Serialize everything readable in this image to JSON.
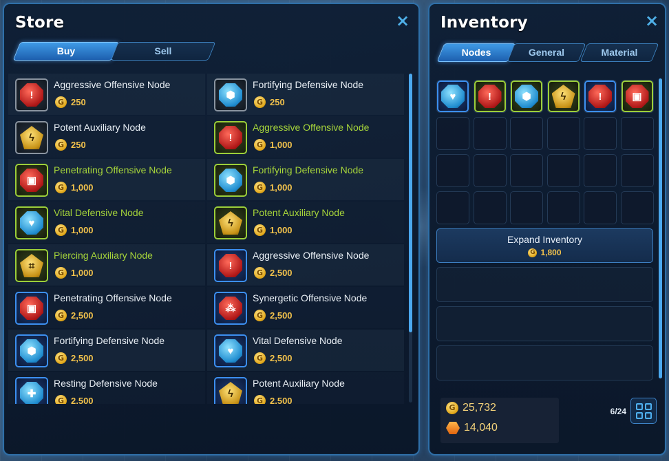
{
  "store": {
    "title": "Store",
    "close_icon": "×",
    "tabs": [
      {
        "label": "Buy",
        "active": true
      },
      {
        "label": "Sell",
        "active": false
      }
    ],
    "items": [
      {
        "name": "Aggressive Offensive Node",
        "price": "250",
        "gem": "red",
        "glyph": "!",
        "frame": "grey",
        "highlight": false
      },
      {
        "name": "Fortifying Defensive Node",
        "price": "250",
        "gem": "blue",
        "glyph": "⬢",
        "frame": "grey",
        "highlight": false
      },
      {
        "name": "Potent Auxiliary Node",
        "price": "250",
        "gem": "gold",
        "glyph": "ϟ",
        "frame": "grey",
        "highlight": false
      },
      {
        "name": "Aggressive Offensive Node",
        "price": "1,000",
        "gem": "red",
        "glyph": "!",
        "frame": "green",
        "highlight": true
      },
      {
        "name": "Penetrating Offensive Node",
        "price": "1,000",
        "gem": "red",
        "glyph": "▣",
        "frame": "green",
        "highlight": true
      },
      {
        "name": "Fortifying Defensive Node",
        "price": "1,000",
        "gem": "blue",
        "glyph": "⬢",
        "frame": "green",
        "highlight": true
      },
      {
        "name": "Vital Defensive Node",
        "price": "1,000",
        "gem": "blue",
        "glyph": "♥",
        "frame": "green",
        "highlight": true
      },
      {
        "name": "Potent Auxiliary Node",
        "price": "1,000",
        "gem": "gold",
        "glyph": "ϟ",
        "frame": "green",
        "highlight": true
      },
      {
        "name": "Piercing Auxiliary Node",
        "price": "1,000",
        "gem": "gold",
        "glyph": "⌗",
        "frame": "green",
        "highlight": true
      },
      {
        "name": "Aggressive Offensive Node",
        "price": "2,500",
        "gem": "red",
        "glyph": "!",
        "frame": "blue",
        "highlight": false
      },
      {
        "name": "Penetrating Offensive Node",
        "price": "2,500",
        "gem": "red",
        "glyph": "▣",
        "frame": "blue",
        "highlight": false
      },
      {
        "name": "Synergetic Offensive Node",
        "price": "2,500",
        "gem": "red",
        "glyph": "⁂",
        "frame": "blue",
        "highlight": false
      },
      {
        "name": "Fortifying Defensive Node",
        "price": "2,500",
        "gem": "blue",
        "glyph": "⬢",
        "frame": "blue",
        "highlight": false
      },
      {
        "name": "Vital Defensive Node",
        "price": "2,500",
        "gem": "blue",
        "glyph": "♥",
        "frame": "blue",
        "highlight": false
      },
      {
        "name": "Resting Defensive Node",
        "price": "2,500",
        "gem": "blue",
        "glyph": "✚",
        "frame": "blue",
        "highlight": false
      },
      {
        "name": "Potent Auxiliary Node",
        "price": "2,500",
        "gem": "gold",
        "glyph": "ϟ",
        "frame": "blue",
        "highlight": false
      }
    ]
  },
  "inventory": {
    "title": "Inventory",
    "close_icon": "×",
    "tabs": [
      {
        "label": "Nodes",
        "active": true
      },
      {
        "label": "General",
        "active": false
      },
      {
        "label": "Material",
        "active": false
      }
    ],
    "slots_filled": [
      {
        "gem": "blue",
        "glyph": "♥",
        "frame": "blue"
      },
      {
        "gem": "red",
        "glyph": "!",
        "frame": "green"
      },
      {
        "gem": "blue",
        "glyph": "⬢",
        "frame": "green"
      },
      {
        "gem": "gold",
        "glyph": "ϟ",
        "frame": "green"
      },
      {
        "gem": "red",
        "glyph": "!",
        "frame": "blue"
      },
      {
        "gem": "red",
        "glyph": "▣",
        "frame": "green"
      }
    ],
    "expand": {
      "label": "Expand Inventory",
      "price": "1,800"
    },
    "gold": "25,732",
    "crystals": "14,040",
    "capacity": "6/24"
  },
  "icons": {
    "coin": "G"
  }
}
